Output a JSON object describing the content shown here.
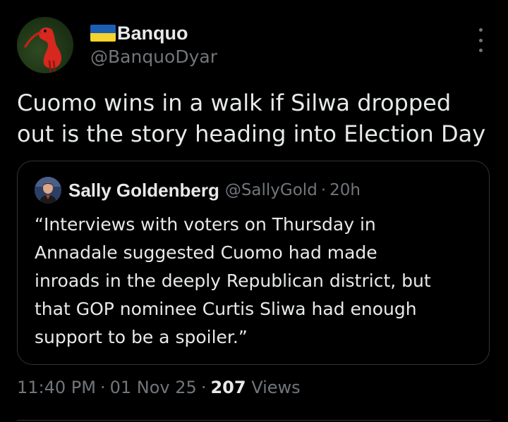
{
  "author": {
    "flag_icon": "ukraine-flag-icon",
    "display_name": "Banquo",
    "handle": "@BanquoDyar"
  },
  "tweet": {
    "text_line1": "Cuomo wins in a walk if Silwa dropped",
    "text_line2": "out is the story heading into Election Day"
  },
  "quoted": {
    "display_name": "Sally Goldenberg",
    "handle": "@SallyGold",
    "separator": "·",
    "time": "20h",
    "text_lines": [
      "“Interviews with voters on Thursday in",
      "Annadale suggested Cuomo had made",
      "inroads in the deeply Republican district, but",
      "that GOP nominee Curtis Sliwa had enough",
      "support to be a spoiler.”"
    ]
  },
  "meta": {
    "time": "11:40 PM",
    "sep1": "·",
    "date": "01 Nov 25",
    "sep2": "·",
    "views_count": "207",
    "views_label": "Views"
  },
  "colors": {
    "background": "#000000",
    "primary_text": "#e7e9ea",
    "secondary_text": "#71767b",
    "border": "#2f3336"
  }
}
